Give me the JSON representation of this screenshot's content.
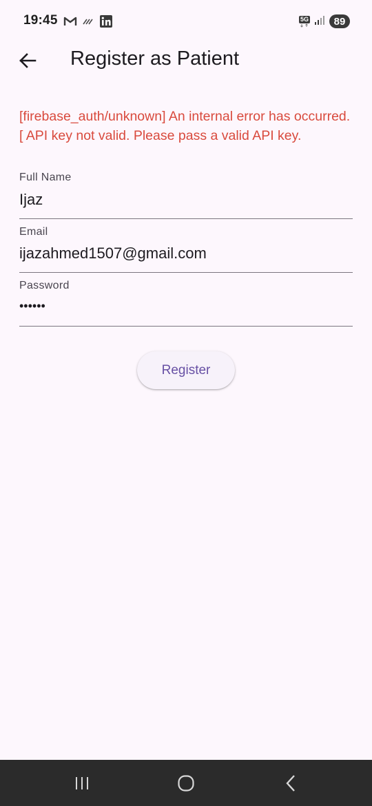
{
  "status_bar": {
    "time": "19:45",
    "left_icons": [
      "gmail-icon",
      "cast-icon",
      "linkedin-icon"
    ],
    "network_label": "5G",
    "battery_level": "89"
  },
  "app_bar": {
    "title": "Register as Patient",
    "back_icon": "arrow-back-icon"
  },
  "error": {
    "message": "[firebase_auth/unknown] An internal error has occurred. [ API key not valid. Please pass a valid API key.",
    "color": "#d94a3d"
  },
  "form": {
    "full_name": {
      "label": "Full Name",
      "value": "Ijaz"
    },
    "email": {
      "label": "Email",
      "value": "ijazahmed1507@gmail.com"
    },
    "password": {
      "label": "Password",
      "value": "••••••"
    }
  },
  "register_button": {
    "label": "Register",
    "color": "#6750a4"
  },
  "nav_bar": {
    "recents_icon": "recents-icon",
    "home_icon": "home-icon",
    "back_icon": "back-chevron-icon"
  },
  "colors": {
    "background": "#fdf7fd",
    "nav_bar": "#2b2b2b"
  }
}
